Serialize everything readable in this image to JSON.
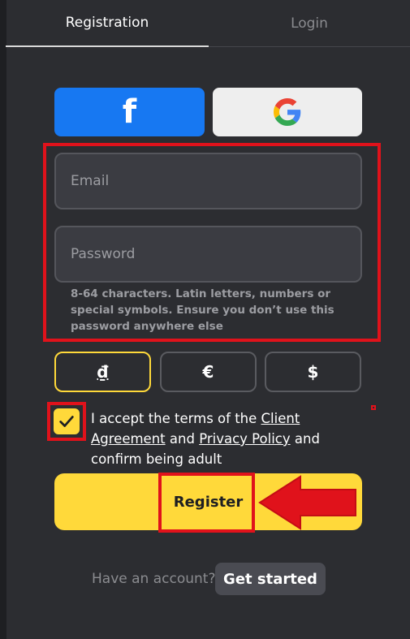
{
  "tabs": [
    {
      "label": "Registration",
      "active": true
    },
    {
      "label": "Login",
      "active": false
    }
  ],
  "social": {
    "facebook_icon": "facebook-icon",
    "google_icon": "google-icon"
  },
  "form": {
    "email_placeholder": "Email",
    "password_placeholder": "Password",
    "password_hint": "8-64 characters. Latin letters, numbers or special symbols. Ensure you don’t use this password anywhere else"
  },
  "currencies": [
    {
      "symbol": "₫",
      "selected": true
    },
    {
      "symbol": "€",
      "selected": false
    },
    {
      "symbol": "$",
      "selected": false
    }
  ],
  "terms": {
    "checked": true,
    "prefix": "I accept the terms of the ",
    "client_agreement": "Client Agreement",
    "and": " and ",
    "privacy_policy": "Privacy Policy",
    "suffix": " and confirm being adult"
  },
  "register": {
    "label": "Register"
  },
  "footer": {
    "have_account": "Have an account?",
    "get_started": "Get started"
  },
  "colors": {
    "accent": "#ffd93a",
    "background": "#2c2d31",
    "facebook": "#1778f2",
    "highlight": "#e0121b"
  }
}
